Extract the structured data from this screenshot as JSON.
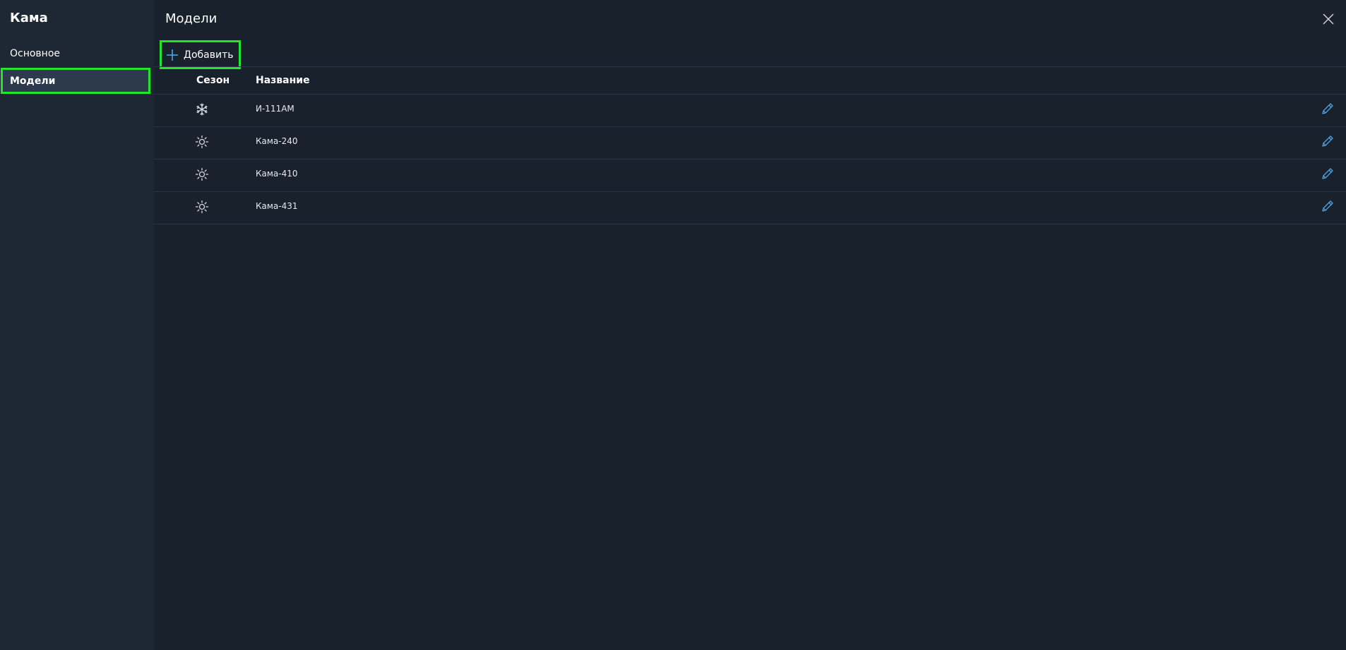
{
  "sidebar": {
    "title": "Кама",
    "items": [
      {
        "label": "Основное"
      },
      {
        "label": "Модели"
      }
    ]
  },
  "main": {
    "title": "Модели",
    "add_label": "Добавить",
    "columns": {
      "season": "Сезон",
      "name": "Название"
    },
    "rows": [
      {
        "season_icon": "snowflake-icon",
        "name": "И-111АМ"
      },
      {
        "season_icon": "sun-icon",
        "name": "Кама-240"
      },
      {
        "season_icon": "sun-icon",
        "name": "Кама-410"
      },
      {
        "season_icon": "sun-icon",
        "name": "Кама-431"
      }
    ]
  },
  "colors": {
    "accent": "#4da3e8",
    "highlight": "#22e629",
    "sidebar_bg": "#1e2835",
    "main_bg": "#18212c"
  }
}
